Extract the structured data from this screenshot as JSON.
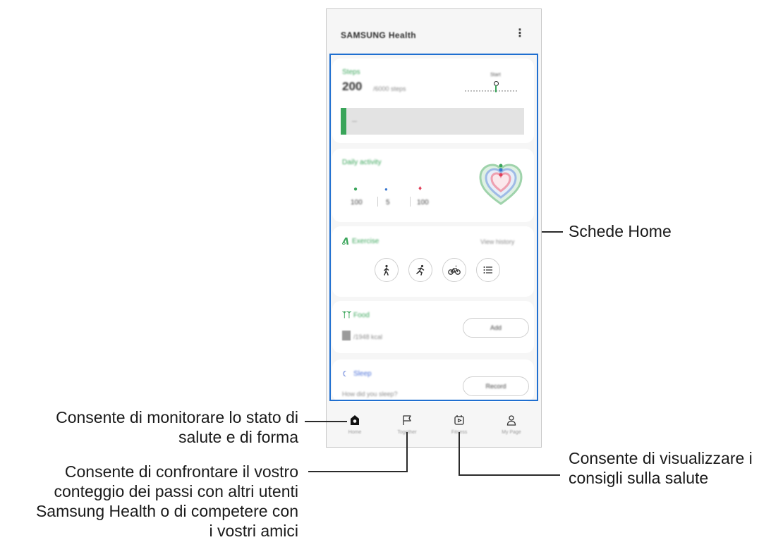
{
  "app": {
    "title": "SAMSUNG Health",
    "menu_icon": "more-vert-icon"
  },
  "cards": {
    "steps": {
      "title": "Steps",
      "value": "200",
      "unit": "/6000 steps",
      "target_label": "Start",
      "bar_text": "—",
      "progress": 0.03
    },
    "activity": {
      "title": "Daily activity",
      "values": [
        "100",
        "5",
        "100"
      ]
    },
    "exercise": {
      "title": "Exercise",
      "link": "View history",
      "buttons": [
        "walk-icon",
        "run-icon",
        "cycle-icon",
        "list-icon"
      ]
    },
    "food": {
      "title": "Food",
      "value": "/1948 kcal",
      "button": "Add"
    },
    "sleep": {
      "title": "Sleep",
      "question": "How did you sleep?",
      "button": "Record"
    }
  },
  "nav": {
    "items": [
      {
        "label": "Home",
        "icon": "home-icon"
      },
      {
        "label": "Together",
        "icon": "flag-icon"
      },
      {
        "label": "Fitness",
        "icon": "fitness-video-icon"
      },
      {
        "label": "My Page",
        "icon": "person-icon"
      }
    ]
  },
  "callouts": {
    "home_cards": "Schede Home",
    "home_line1": "Consente di monitorare lo stato di",
    "home_line2": "salute e di forma",
    "together_line1": "Consente di confrontare il vostro",
    "together_line2": "conteggio dei passi con altri utenti",
    "together_line3": "Samsung Health o di competere con",
    "together_line4": "i vostri amici",
    "fitness_line1": "Consente di visualizzare i",
    "fitness_line2": "consigli sulla salute"
  },
  "colors": {
    "highlight": "#1f6fd0",
    "accent_green": "#3aa55a",
    "panel": "#f6f6f6"
  }
}
